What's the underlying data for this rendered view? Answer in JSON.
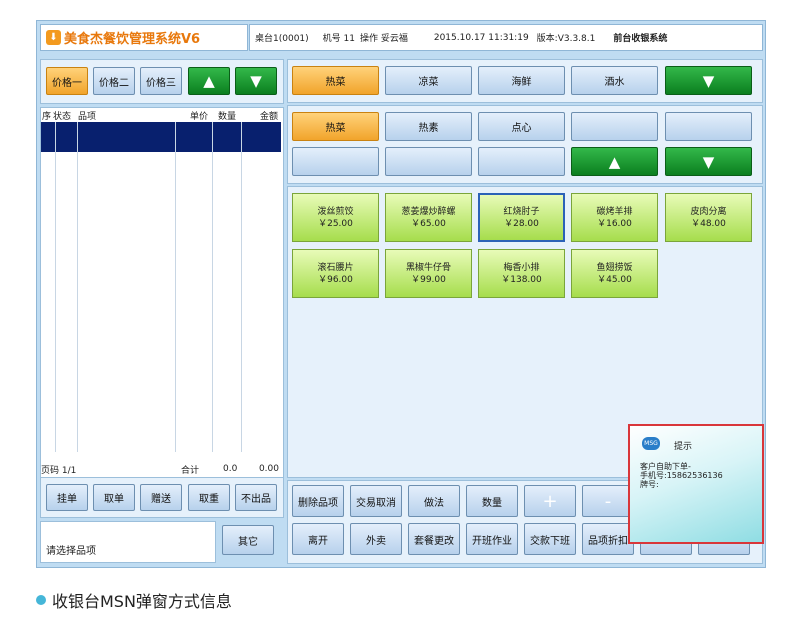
{
  "app": {
    "title": "美食杰餐饮管理系统V6",
    "logo_icon": "app-logo-icon"
  },
  "header": {
    "table": "桌台1(0001)",
    "machine": "机号 11",
    "operator": "操作 妥云福",
    "datetime": "2015.10.17 11:31:19",
    "version": "版本:V3.3.8.1",
    "mode": "前台收银系统"
  },
  "price_tabs": [
    "价格一",
    "价格二",
    "价格三"
  ],
  "order_table": {
    "headers": [
      "序",
      "状态",
      "品项",
      "单价",
      "数量",
      "金额"
    ],
    "footer": {
      "page": "页码 1/1",
      "total_label": "合计",
      "qty": "0.0",
      "amount": "0.00"
    }
  },
  "categories_top": [
    "热菜",
    "凉菜",
    "海鲜",
    "酒水"
  ],
  "categories_sub": [
    "热菜",
    "热素",
    "点心"
  ],
  "menu_items": [
    {
      "name": "泼丝煎饺",
      "price": "￥25.00"
    },
    {
      "name": "葱姜爆炒醉螺",
      "price": "￥65.00"
    },
    {
      "name": "红烧肘子",
      "price": "￥28.00"
    },
    {
      "name": "碳烤羊排",
      "price": "￥16.00"
    },
    {
      "name": "皮肉分离",
      "price": "￥48.00"
    },
    {
      "name": "滚石腰片",
      "price": "￥96.00"
    },
    {
      "name": "黑椒牛仔骨",
      "price": "￥99.00"
    },
    {
      "name": "梅香小排",
      "price": "￥138.00"
    },
    {
      "name": "鱼翅捞饭",
      "price": "￥45.00"
    }
  ],
  "order_buttons": [
    "挂单",
    "取单",
    "赠送",
    "取重",
    "不出品"
  ],
  "status_text": "请选择品项",
  "other_button": "其它",
  "action_row1": [
    "删除品项",
    "交易取消",
    "做法",
    "数量",
    "+",
    "-"
  ],
  "action_row2": [
    "离开",
    "外卖",
    "套餐更改",
    "开班作业",
    "交款下班",
    "品项折扣"
  ],
  "popup": {
    "icon_text": "MSG",
    "title": "提示",
    "lines": [
      "客户自助下单-",
      "手机号:15862536136",
      "牌号:"
    ]
  },
  "caption": "收银台MSN弹窗方式信息",
  "icons": {
    "up": "▲",
    "down": "▼"
  },
  "colors": {
    "accent_orange": "#f1a42b",
    "green": "#0b7f1f",
    "popup_border": "#d9363a"
  }
}
